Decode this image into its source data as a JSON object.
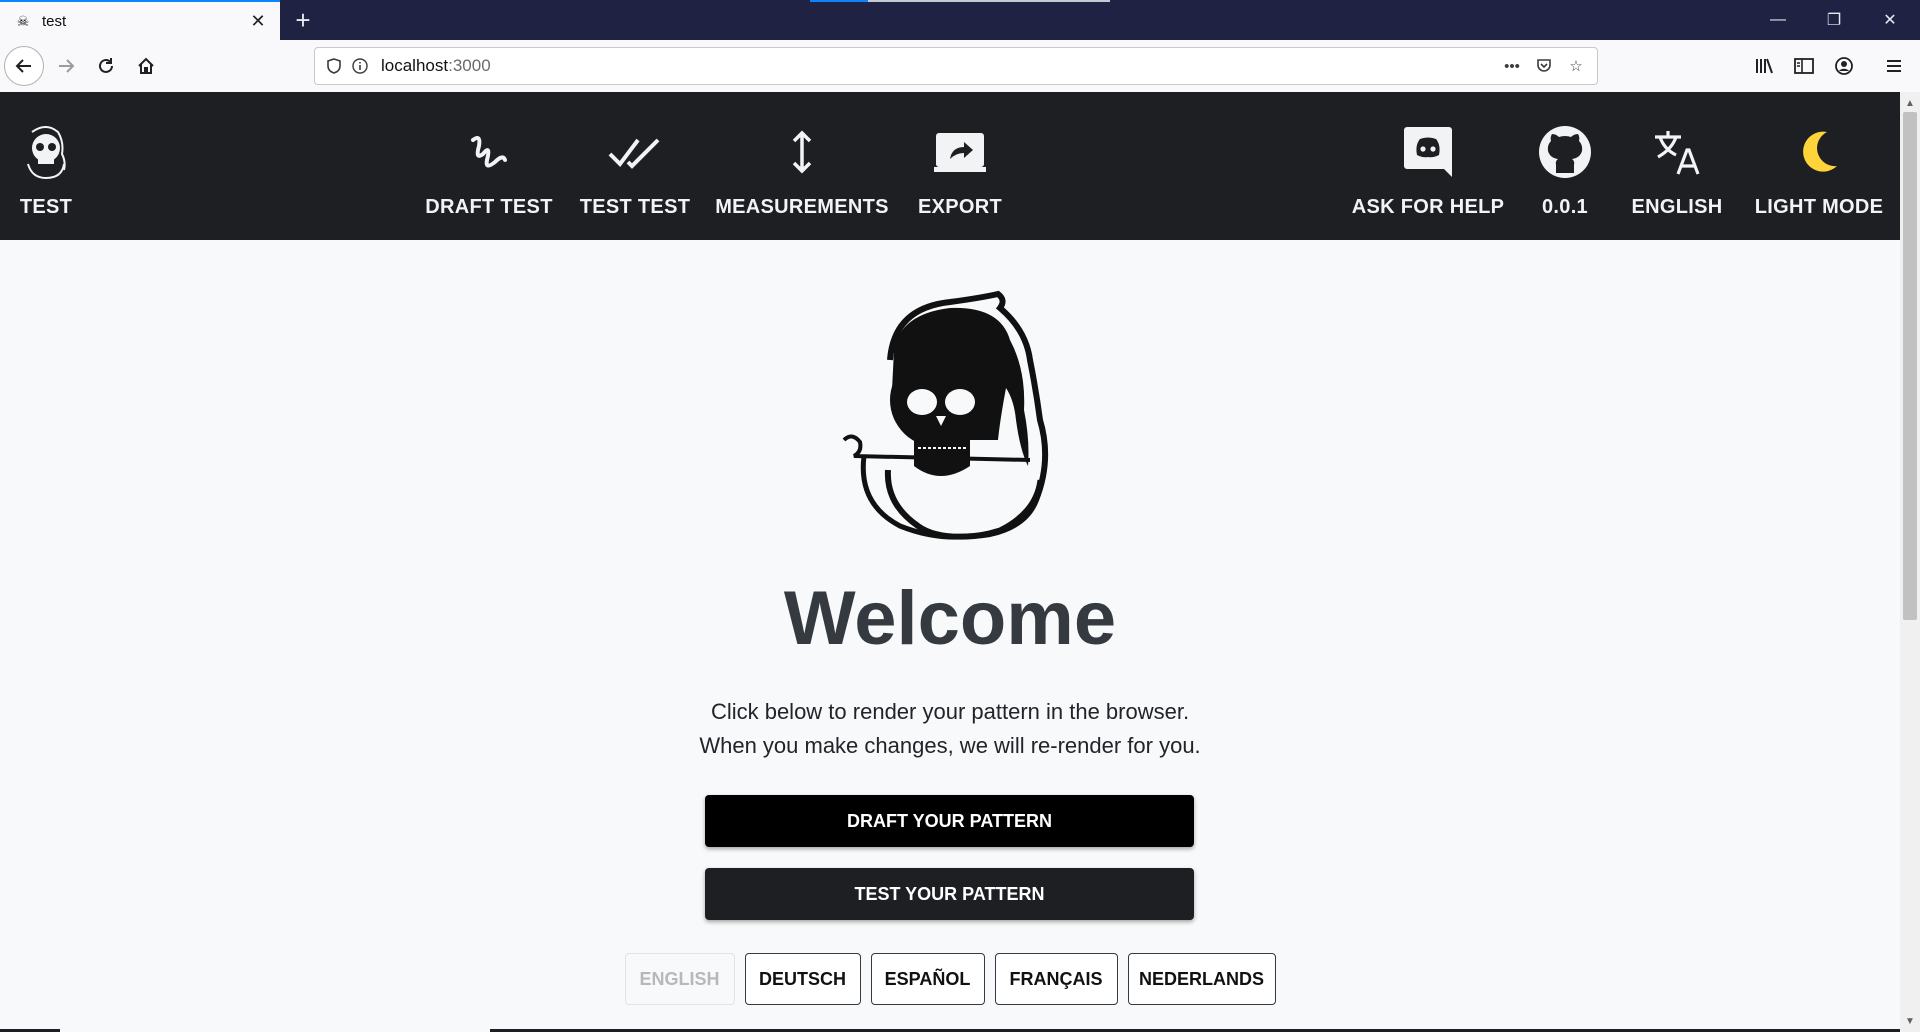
{
  "browser": {
    "tab_title": "test",
    "url_host": "localhost",
    "url_port": ":3000"
  },
  "header": {
    "brand": "TEST",
    "nav": [
      {
        "label": "DRAFT TEST",
        "icon": "draft-icon"
      },
      {
        "label": "TEST TEST",
        "icon": "double-check-icon"
      },
      {
        "label": "MEASUREMENTS",
        "icon": "vertical-arrows-icon"
      },
      {
        "label": "EXPORT",
        "icon": "export-icon"
      }
    ],
    "right": [
      {
        "label": "ASK FOR HELP",
        "icon": "discord-icon"
      },
      {
        "label": "0.0.1",
        "icon": "github-icon"
      },
      {
        "label": "ENGLISH",
        "icon": "translate-icon"
      },
      {
        "label": "LIGHT MODE",
        "icon": "moon-icon"
      }
    ]
  },
  "main": {
    "heading": "Welcome",
    "lead_line1": "Click below to render your pattern in the browser.",
    "lead_line2": "When you make changes, we will re-render for you.",
    "draft_button": "DRAFT YOUR PATTERN",
    "test_button": "TEST YOUR PATTERN",
    "languages": [
      "ENGLISH",
      "DEUTSCH",
      "ESPAÑOL",
      "FRANÇAIS",
      "NEDERLANDS"
    ],
    "active_language": "ENGLISH"
  },
  "colors": {
    "header_bg": "#1d1f22",
    "page_bg": "#f8f9fa",
    "heading": "#343a40",
    "moon": "#ffd43b",
    "tabbar_bg": "#1f2243"
  }
}
